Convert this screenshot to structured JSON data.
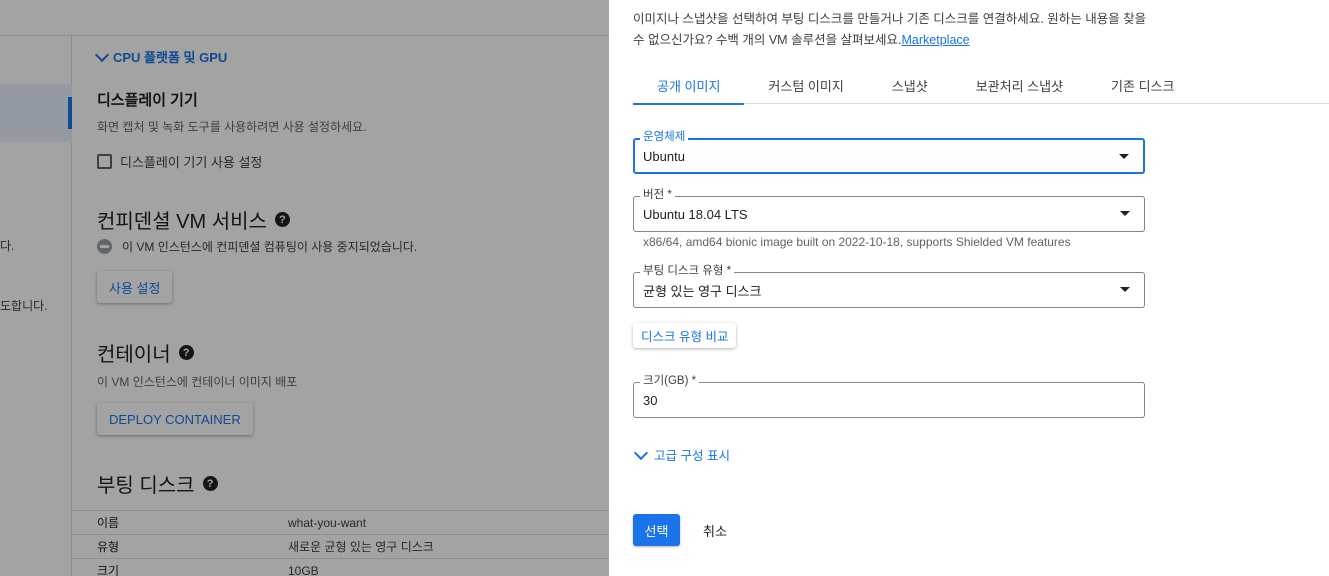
{
  "background": {
    "left_texts": [
      "다.",
      "도합니다."
    ],
    "cpu_link": "CPU 플랫폼 및 GPU",
    "display": {
      "title": "디스플레이 기기",
      "description": "화면 캡처 및 녹화 도구를 사용하려면 사용 설정하세요.",
      "checkbox_label": "디스플레이 기기 사용 설정"
    },
    "confidential": {
      "title": "컨피덴셜 VM 서비스",
      "info": "이 VM 인스턴스에 컨피덴셜 컴퓨팅이 사용 중지되었습니다.",
      "button": "사용 설정"
    },
    "container": {
      "title": "컨테이너",
      "description": "이 VM 인스턴스에 컨테이너 이미지 배포",
      "button": "DEPLOY CONTAINER"
    },
    "boot_disk": {
      "title": "부팅 디스크",
      "rows": [
        {
          "key": "이름",
          "value": "what-you-want"
        },
        {
          "key": "유형",
          "value": "새로운 균형 있는 영구 디스크"
        },
        {
          "key": "크기",
          "value": "10GB"
        }
      ]
    }
  },
  "panel": {
    "intro": "이미지나 스냅샷을 선택하여 부팅 디스크를 만들거나 기존 디스크를 연결하세요. 원하는 내용을 찾을 수 없으신가요? 수백 개의 VM 솔루션을 살펴보세요.",
    "intro_link": "Marketplace",
    "tabs": [
      {
        "label": "공개 이미지",
        "active": true
      },
      {
        "label": "커스텀 이미지",
        "active": false
      },
      {
        "label": "스냅샷",
        "active": false
      },
      {
        "label": "보관처리 스냅샷",
        "active": false
      },
      {
        "label": "기존 디스크",
        "active": false
      }
    ],
    "os": {
      "label": "운영체제",
      "value": "Ubuntu"
    },
    "version": {
      "label": "버전 *",
      "value": "Ubuntu 18.04 LTS",
      "hint": "x86/64, amd64 bionic image built on 2022-10-18, supports Shielded VM features"
    },
    "disk_type": {
      "label": "부팅 디스크 유형 *",
      "value": "균형 있는 영구 디스크"
    },
    "compare_button": "디스크 유형 비교",
    "size": {
      "label": "크기(GB) *",
      "value": "30"
    },
    "advanced_link": "고급 구성 표시",
    "select_button": "선택",
    "cancel_button": "취소"
  },
  "colors": {
    "accent": "#1a73e8",
    "overlay": "rgba(0,0,0,0.36)"
  }
}
